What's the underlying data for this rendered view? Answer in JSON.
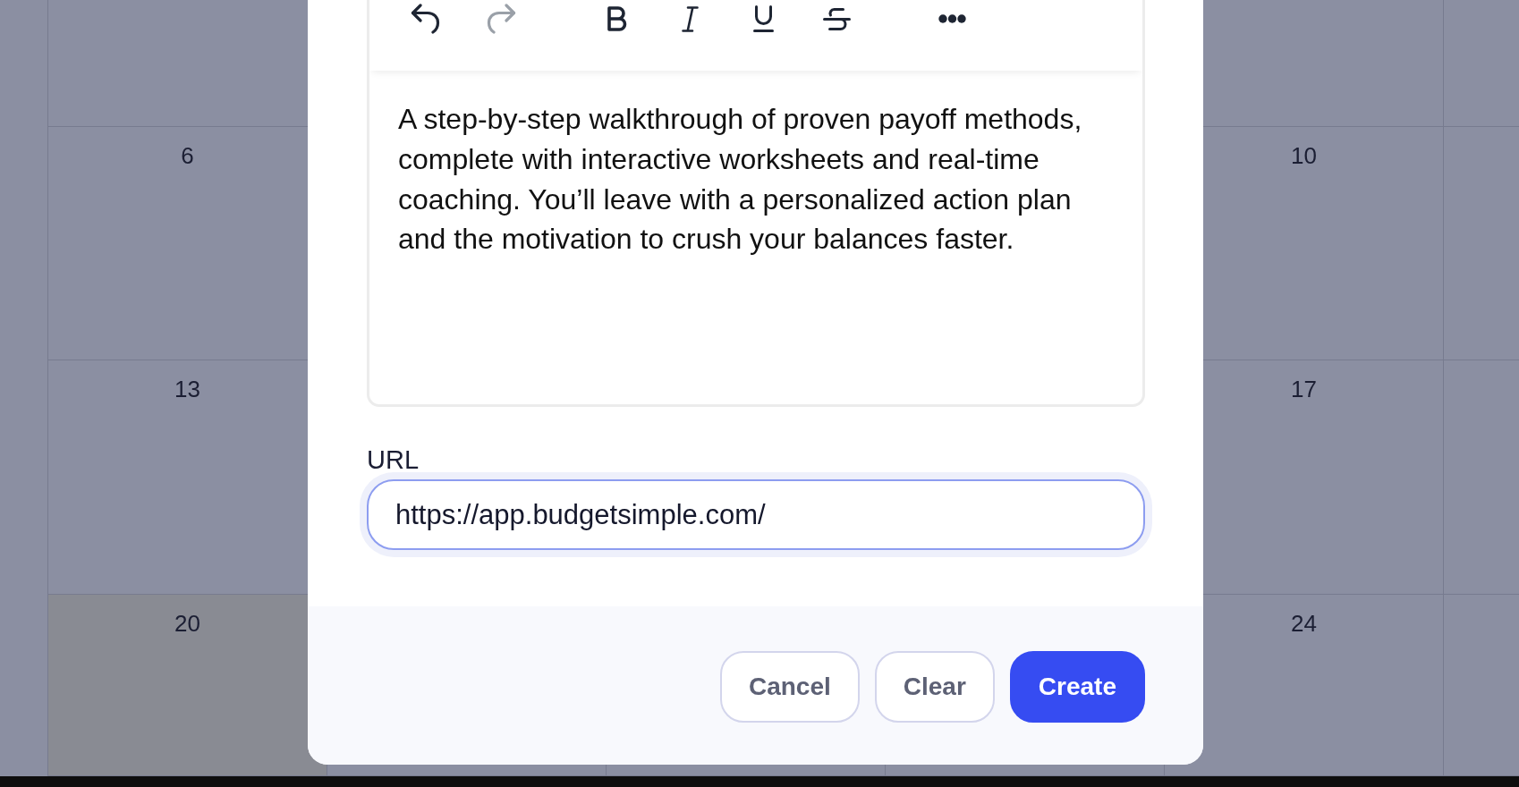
{
  "calendar": {
    "weeks": [
      {
        "days": [
          {
            "label": "6",
            "highlighted": false
          },
          {
            "label": "10",
            "highlighted": false
          }
        ]
      },
      {
        "days": [
          {
            "label": "13",
            "highlighted": false
          },
          {
            "label": "17",
            "highlighted": false
          }
        ]
      },
      {
        "days": [
          {
            "label": "20",
            "highlighted": true
          },
          {
            "label": "24",
            "highlighted": false
          }
        ]
      }
    ]
  },
  "dialog": {
    "editor": {
      "toolbar": {
        "groups": [
          {
            "buttons": [
              {
                "kind": "undo",
                "disabled": false
              },
              {
                "kind": "redo",
                "disabled": true
              }
            ]
          },
          {
            "buttons": [
              {
                "kind": "bold",
                "disabled": false
              },
              {
                "kind": "italic",
                "disabled": false
              },
              {
                "kind": "underline",
                "disabled": false
              },
              {
                "kind": "strikethrough",
                "disabled": false
              }
            ]
          },
          {
            "buttons": [
              {
                "kind": "more",
                "disabled": false
              }
            ]
          }
        ]
      },
      "text": "A step-by-step walkthrough of proven payoff methods, complete with interactive worksheets and real-time coaching. You’ll leave with a personalized action plan and the motivation to crush your balances faster."
    },
    "url_field": {
      "label": "URL",
      "value": "https://app.budgetsimple.com/",
      "focused": true
    },
    "buttons": [
      {
        "label": "Cancel",
        "kind": "outline"
      },
      {
        "label": "Clear",
        "kind": "outline"
      },
      {
        "label": "Create",
        "kind": "primary"
      }
    ]
  }
}
